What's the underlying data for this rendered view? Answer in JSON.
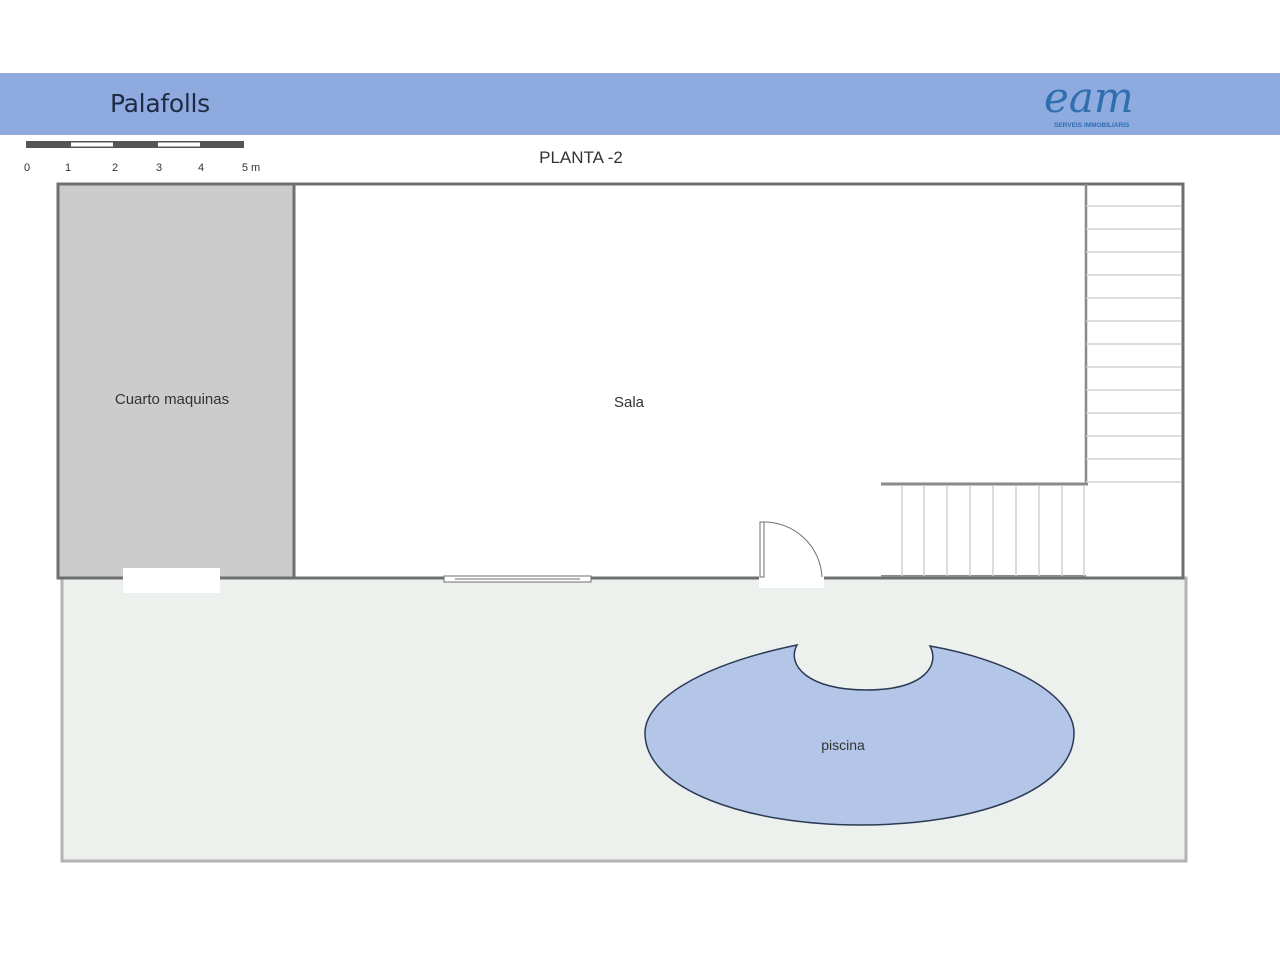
{
  "header": {
    "title": "Palafolls",
    "logo_text": "eam",
    "logo_subtitle": "SERVEIS IMMOBILIARIS"
  },
  "plan": {
    "floor_label": "PLANTA -2",
    "scale_labels": [
      "0",
      "1",
      "2",
      "3",
      "4",
      "5 m"
    ],
    "rooms": {
      "machine_room": "Cuarto maquinas",
      "living_room": "Sala",
      "pool": "piscina"
    }
  },
  "colors": {
    "header_bar": "#8eaadf",
    "machine_room_fill": "#cccccc",
    "terrace_fill": "#edf1ee",
    "pool_fill": "#b4c6e7",
    "wall": "#6f6f6f",
    "logo": "#2f6fb0"
  }
}
